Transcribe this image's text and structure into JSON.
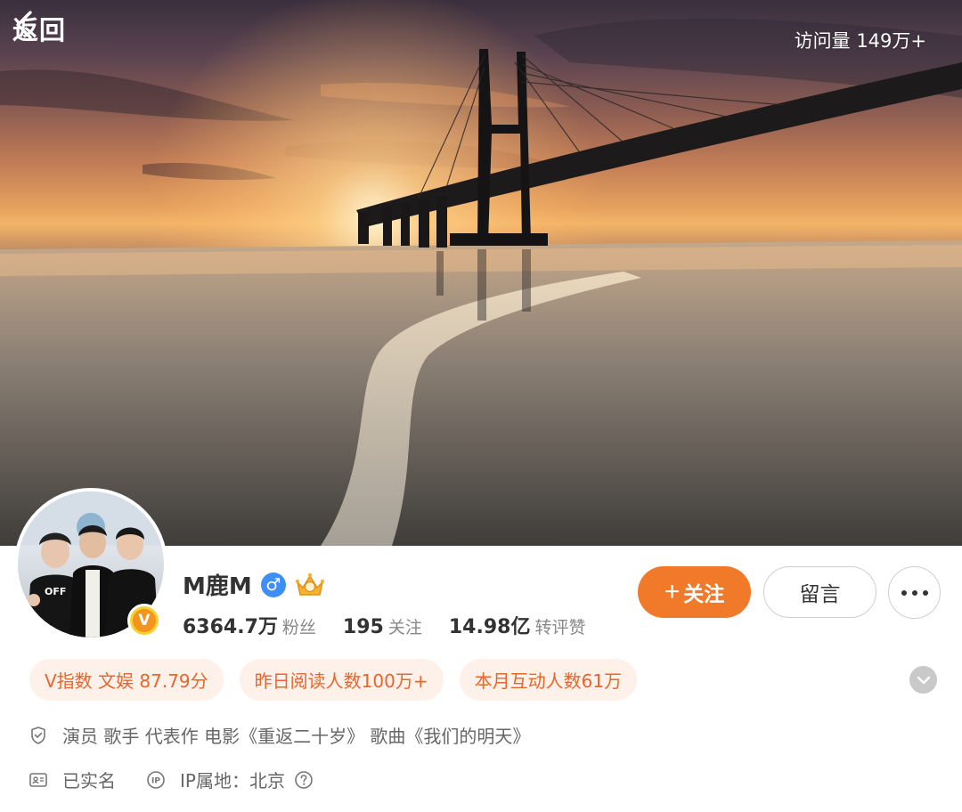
{
  "nav": {
    "back_label": "返回",
    "visits": "访问量 149万+"
  },
  "profile": {
    "name": "M鹿M",
    "gender_symbol": "♂",
    "verified_badge": "V",
    "stats": [
      {
        "value": "6364.7万",
        "label": "粉丝"
      },
      {
        "value": "195",
        "label": "关注"
      },
      {
        "value": "14.98亿",
        "label": "转评赞"
      }
    ]
  },
  "actions": {
    "follow_plus": "+",
    "follow_label": "关注",
    "message_label": "留言"
  },
  "tags": [
    "V指数 文娱 87.79分",
    "昨日阅读人数100万+",
    "本月互动人数61万"
  ],
  "info": {
    "bio": "演员 歌手 代表作 电影《重返二十岁》 歌曲《我们的明天》",
    "realname": "已实名",
    "ip_location": "IP属地：北京"
  },
  "colors": {
    "accent": "#f0792a",
    "tag_bg": "#fdf1ea",
    "tag_text": "#e8652c",
    "gender_blue": "#3f8ef7"
  },
  "icons": [
    "chevron-left-icon",
    "gender-male-icon",
    "crown-badge-icon",
    "verified-v-icon",
    "more-dots-icon",
    "chevron-down-icon",
    "shield-check-icon",
    "id-card-icon",
    "ip-icon",
    "question-icon"
  ]
}
